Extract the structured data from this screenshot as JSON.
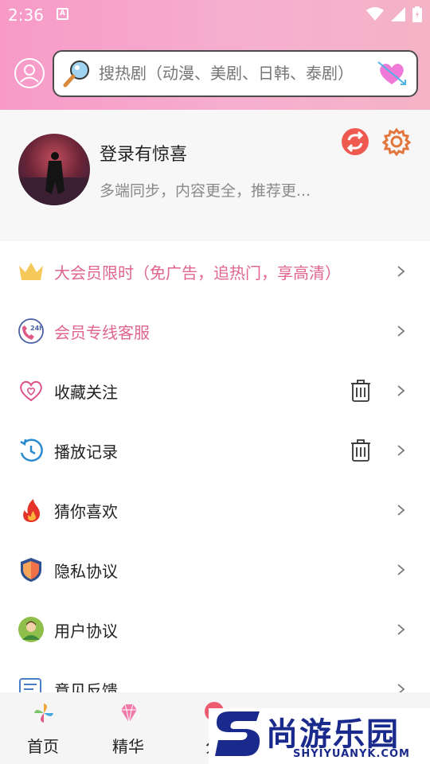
{
  "status_bar": {
    "time": "2:36",
    "notif_letter": "A"
  },
  "search": {
    "placeholder": "搜热剧（动漫、美剧、日韩、泰剧）"
  },
  "profile": {
    "title": "登录有惊喜",
    "subtitle": "多端同步，内容更全，推荐更..."
  },
  "menu": [
    {
      "label": "大会员限时（免广告，追热门，享高清）",
      "icon": "crown-icon",
      "accent": true
    },
    {
      "label": "会员专线客服",
      "icon": "phone-24h-icon",
      "accent": true
    },
    {
      "label": "收藏关注",
      "icon": "heart-outline-icon",
      "trash": true
    },
    {
      "label": "播放记录",
      "icon": "history-icon",
      "trash": true
    },
    {
      "label": "猜你喜欢",
      "icon": "fire-icon"
    },
    {
      "label": "隐私协议",
      "icon": "shield-icon"
    },
    {
      "label": "用户协议",
      "icon": "user-avatar-icon"
    },
    {
      "label": "意见反馈",
      "icon": "feedback-icon"
    }
  ],
  "tabs": [
    {
      "label": "首页",
      "icon": "pinwheel-icon"
    },
    {
      "label": "精华",
      "icon": "diamond-icon"
    },
    {
      "label": "分",
      "icon": "category-icon"
    }
  ],
  "watermark": {
    "brand": "尚游乐园",
    "url": "SHYIYUANYK.COM"
  },
  "colors": {
    "header_pink": "#f79ac8",
    "accent_pink": "#e06590",
    "watermark_blue": "#1a2a8c"
  }
}
